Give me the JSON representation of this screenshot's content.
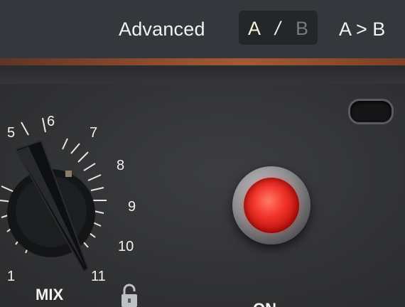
{
  "header": {
    "advanced_label": "Advanced",
    "ab": {
      "a": "A",
      "separator": "/",
      "b": "B"
    },
    "copy_label": "A > B"
  },
  "mix": {
    "label": "MIX",
    "scale": [
      "1",
      "5",
      "6",
      "7",
      "8",
      "9",
      "10",
      "11"
    ]
  },
  "on": {
    "label": "ON"
  },
  "colors": {
    "topbar": "#34373b",
    "panel": "#323335",
    "lamp_red": "#f2352c",
    "label_text": "#f2f2f2",
    "inactive_b": "#777a7d"
  },
  "icons": [
    "unlocked-padlock-icon"
  ]
}
